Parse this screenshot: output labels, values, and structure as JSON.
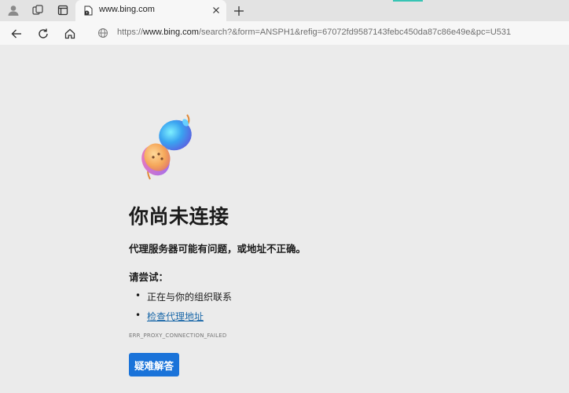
{
  "browser": {
    "tab": {
      "title": "www.bing.com"
    },
    "address": {
      "prefix": "https://",
      "host": "www.bing.com",
      "path": "/search?&form=ANSPH1&refig=67072fd9587143febc450da87c86e49e&pc=U531"
    },
    "icons": {
      "profile": "profile-icon",
      "workspaces": "workspaces-icon",
      "tab_actions": "tab-actions-icon",
      "back": "back-arrow-icon",
      "refresh": "refresh-icon",
      "home": "home-icon",
      "site_info": "globe-icon",
      "close_tab": "close-icon",
      "new_tab": "plus-icon"
    },
    "colors": {
      "accent": "#38c4b4"
    }
  },
  "error_page": {
    "title": "你尚未连接",
    "subtitle": "代理服务器可能有问题，或地址不正确。",
    "try_label": "请尝试：",
    "suggestions": [
      {
        "text": "正在与你的组织联系",
        "is_link": false
      },
      {
        "text": "检查代理地址",
        "is_link": true
      }
    ],
    "error_code": "ERR_PROXY_CONNECTION_FAILED",
    "diagnose_button": "疑难解答",
    "colors": {
      "button": "#1a73d9",
      "link": "#1967a8"
    }
  }
}
